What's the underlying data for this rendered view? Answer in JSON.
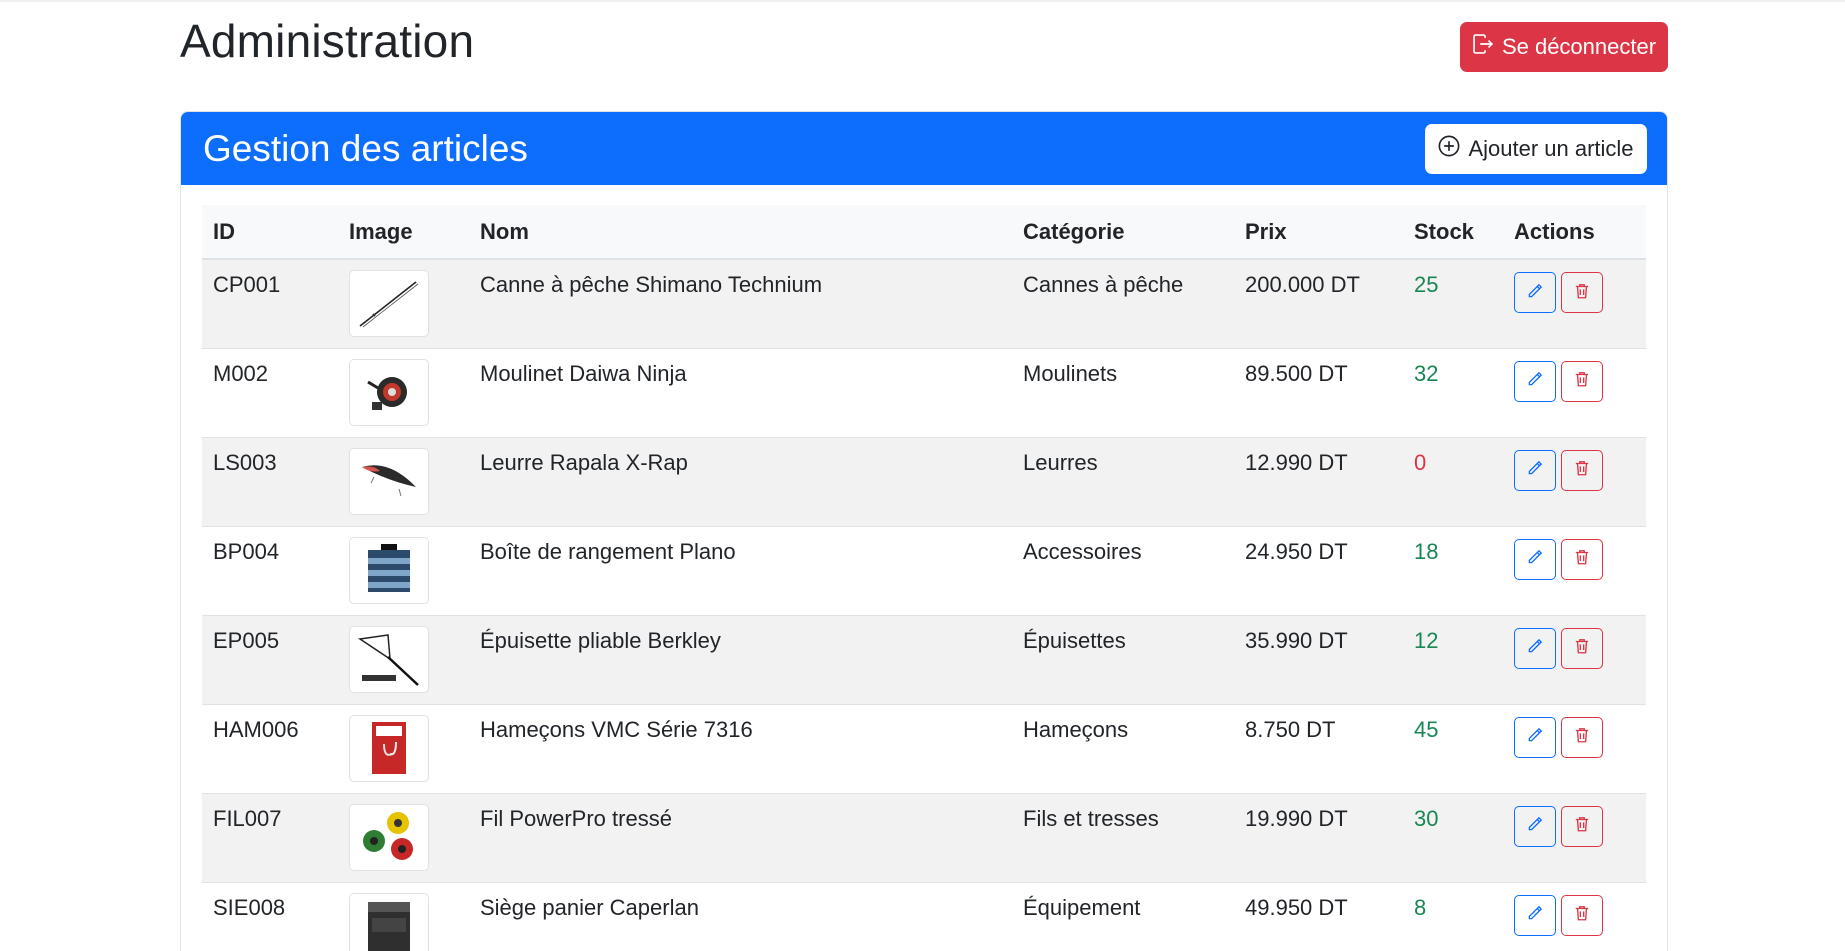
{
  "page": {
    "title": "Administration",
    "logout_label": "Se déconnecter"
  },
  "colors": {
    "primary": "#0d6efd",
    "danger": "#dc3545",
    "stock_ok": "#198754",
    "stock_zero": "#dc3545"
  },
  "card": {
    "title": "Gestion des articles",
    "add_label": "Ajouter un article"
  },
  "table": {
    "headers": [
      "ID",
      "Image",
      "Nom",
      "Catégorie",
      "Prix",
      "Stock",
      "Actions"
    ],
    "rows": [
      {
        "id": "CP001",
        "image": "rod-image",
        "name": "Canne à pêche Shimano Technium",
        "category": "Cannes à pêche",
        "price": "200.000 DT",
        "stock": "25"
      },
      {
        "id": "M002",
        "image": "reel-image",
        "name": "Moulinet Daiwa Ninja",
        "category": "Moulinets",
        "price": "89.500 DT",
        "stock": "32"
      },
      {
        "id": "LS003",
        "image": "lure-image",
        "name": "Leurre Rapala X-Rap",
        "category": "Leurres",
        "price": "12.990 DT",
        "stock": "0"
      },
      {
        "id": "BP004",
        "image": "tackle-box-image",
        "name": "Boîte de rangement Plano",
        "category": "Accessoires",
        "price": "24.950 DT",
        "stock": "18"
      },
      {
        "id": "EP005",
        "image": "landing-net-image",
        "name": "Épuisette pliable Berkley",
        "category": "Épuisettes",
        "price": "35.990 DT",
        "stock": "12"
      },
      {
        "id": "HAM006",
        "image": "hooks-image",
        "name": "Hameçons VMC Série 7316",
        "category": "Hameçons",
        "price": "8.750 DT",
        "stock": "45"
      },
      {
        "id": "FIL007",
        "image": "braided-line-image",
        "name": "Fil PowerPro tressé",
        "category": "Fils et tresses",
        "price": "19.990 DT",
        "stock": "30"
      },
      {
        "id": "SIE008",
        "image": "seat-box-image",
        "name": "Siège panier Caperlan",
        "category": "Équipement",
        "price": "49.950 DT",
        "stock": "8"
      }
    ]
  },
  "icons": {
    "logout": "logout-icon",
    "add": "plus-circle-icon",
    "edit": "pencil-icon",
    "delete": "trash-icon"
  }
}
